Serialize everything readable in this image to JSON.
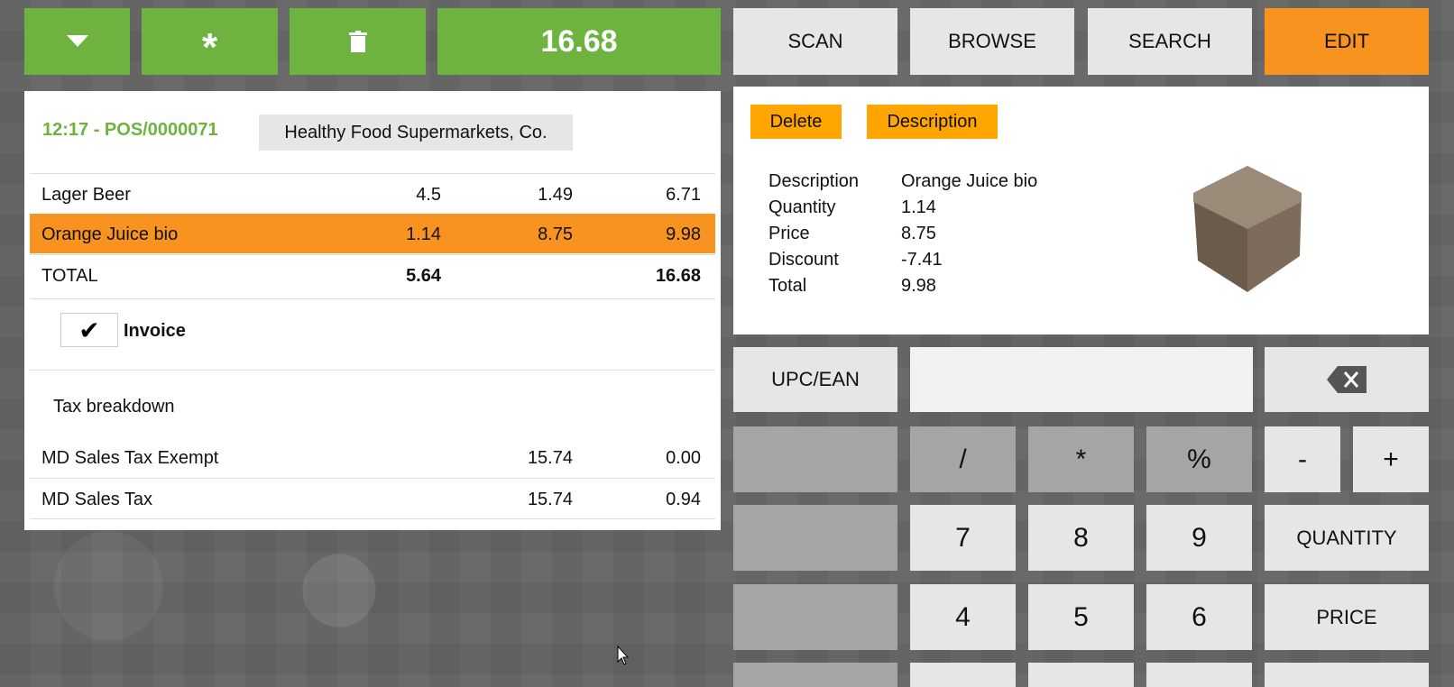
{
  "topbar": {
    "dropdown_icon": "caret-down-icon",
    "star_icon": "asterisk-icon",
    "trash_icon": "trash-icon",
    "total": "16.68",
    "scan": "SCAN",
    "browse": "BROWSE",
    "search": "SEARCH",
    "edit": "EDIT"
  },
  "order": {
    "header": "12:17 - POS/0000071",
    "customer": "Healthy Food Supermarkets, Co.",
    "lines": [
      {
        "name": "Lager Beer",
        "qty": "4.5",
        "price": "1.49",
        "total": "6.71"
      },
      {
        "name": "Orange Juice bio",
        "qty": "1.14",
        "price": "8.75",
        "total": "9.98"
      }
    ],
    "total_row": {
      "label": "TOTAL",
      "qty": "5.64",
      "total": "16.68"
    },
    "invoice_label": "Invoice",
    "invoice_checked": "✔",
    "tax_title": "Tax breakdown",
    "taxes": [
      {
        "name": "MD Sales Tax Exempt",
        "base": "15.74",
        "amount": "0.00"
      },
      {
        "name": "MD Sales Tax",
        "base": "15.74",
        "amount": "0.94"
      }
    ]
  },
  "detail": {
    "delete": "Delete",
    "description_btn": "Description",
    "rows": [
      {
        "k": "Description",
        "v": "Orange Juice bio"
      },
      {
        "k": "Quantity",
        "v": "1.14"
      },
      {
        "k": "Price",
        "v": "8.75"
      },
      {
        "k": "Discount",
        "v": "-7.41"
      },
      {
        "k": "Total",
        "v": "9.98"
      }
    ],
    "image_icon": "product-box-icon"
  },
  "keypad": {
    "upc_label": "UPC/EAN",
    "input_value": "",
    "backspace_icon": "backspace-icon",
    "slash": "/",
    "star": "*",
    "percent": "%",
    "minus": "-",
    "plus": "+",
    "seven": "7",
    "eight": "8",
    "nine": "9",
    "quantity": "QUANTITY",
    "four": "4",
    "five": "5",
    "six": "6",
    "price": "PRICE"
  },
  "colors": {
    "green": "#6eb33f",
    "orange": "#f7931e",
    "tab_orange": "#ffa500",
    "key_grey": "#e6e6e6",
    "op_grey": "#a5a5a5"
  }
}
